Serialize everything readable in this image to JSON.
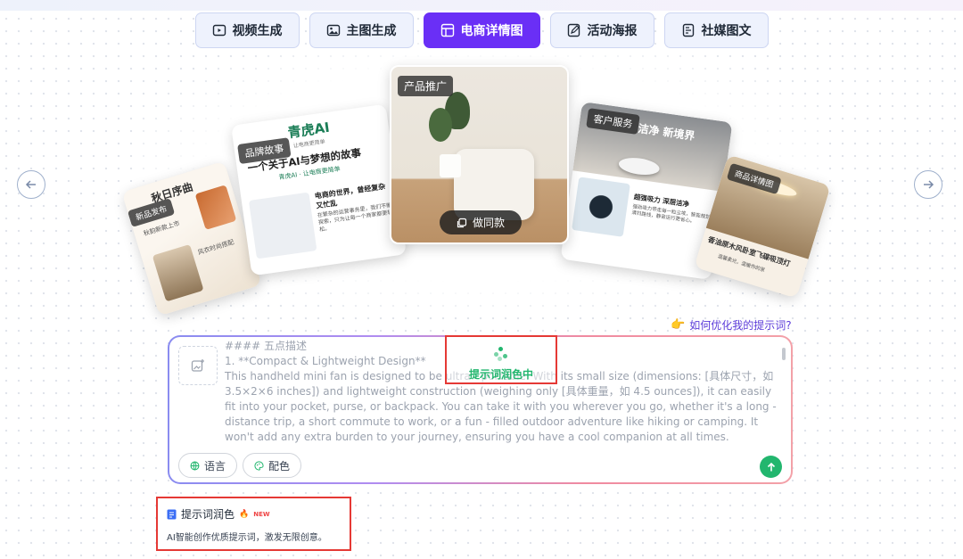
{
  "tabs": [
    {
      "label": "视频生成",
      "icon": "video-icon",
      "active": false
    },
    {
      "label": "主图生成",
      "icon": "image-icon",
      "active": false
    },
    {
      "label": "电商详情图",
      "icon": "layout-icon",
      "active": true
    },
    {
      "label": "活动海报",
      "icon": "edit-icon",
      "active": false
    },
    {
      "label": "社媒图文",
      "icon": "document-icon",
      "active": false
    }
  ],
  "carousel": {
    "cards": [
      {
        "badge": "新品发布",
        "heading": "秋日序曲",
        "lines": [
          "秋韵新款上市",
          "风衣时尚搭配"
        ]
      },
      {
        "badge": "品牌故事",
        "brand": "青虎AI",
        "brand_sub": "让电商更简单",
        "title": "一个关于AI与梦想的故事",
        "subtitle": "青虎AI · 让电商更简单",
        "body_title": "电商的世界，曾经复杂又忙乱",
        "body": "在繁杂的运营事务里，我们不断探索，只为让每一个商家都更轻松。"
      },
      {
        "badge": "产品推广",
        "button": "做同款"
      },
      {
        "badge": "客户服务",
        "title": "洁净 新境界",
        "feature": "超强吸力 深层洁净",
        "body": "强劲吸力带走每一粒尘埃，智能规划清扫路线，静音运行更省心。"
      },
      {
        "badge": "商品详情图",
        "title": "香油原木风卧室飞碟吸顶灯",
        "sub": "温馨柔光，温暖你的家"
      }
    ]
  },
  "hint": {
    "icon": "pointing-hand-icon",
    "text": "如何优化我的提示词?"
  },
  "editor": {
    "prompt_text": "#### 五点描述\n1. **Compact & Lightweight Design**\nThis handheld mini fan is designed to be ultra - portable. With its small size (dimensions: [具体尺寸，如 3.5×2×6 inches]) and lightweight construction (weighing only [具体重量，如 4.5 ounces]), it can easily fit into your pocket, purse, or backpack. You can take it with you wherever you go, whether it's a long - distance trip, a short commute to work, or a fun - filled outdoor adventure like hiking or camping. It won't add any extra burden to your journey, ensuring you have a cool companion at all times.",
    "language_label": "语言",
    "color_label": "配色",
    "loading_text": "提示词润色中"
  },
  "popup": {
    "title": "提示词润色",
    "new_tag": "NEW",
    "desc": "AI智能创作优质提示词，激发无限创意。"
  },
  "colors": {
    "accent": "#6a2ff6",
    "green": "#22b66e",
    "highlight": "#e53935"
  }
}
